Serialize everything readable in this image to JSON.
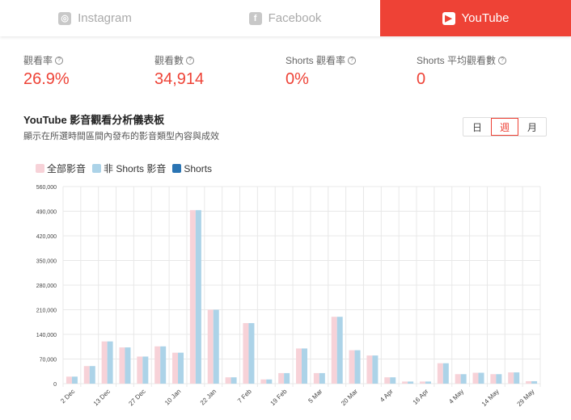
{
  "tabs": [
    {
      "label": "Instagram",
      "icon": "instagram-icon",
      "glyph": "◎"
    },
    {
      "label": "Facebook",
      "icon": "facebook-icon",
      "glyph": "f"
    },
    {
      "label": "YouTube",
      "icon": "youtube-icon",
      "glyph": "▶"
    }
  ],
  "active_tab": 2,
  "metrics": [
    {
      "label": "觀看率",
      "value": "26.9%"
    },
    {
      "label": "觀看數",
      "value": "34,914"
    },
    {
      "label": "Shorts 觀看率",
      "value": "0%"
    },
    {
      "label": "Shorts 平均觀看數",
      "value": "0"
    }
  ],
  "help_glyph": "?",
  "dashboard": {
    "title": "YouTube 影音觀看分析儀表板",
    "subtitle": "顯示在所選時間區間內發布的影音類型內容與成效"
  },
  "period": {
    "options": [
      "日",
      "週",
      "月"
    ],
    "selected": 1
  },
  "colors": {
    "accent": "#ee4236",
    "all": "#f7d2d8",
    "non_shorts": "#acd3e8",
    "shorts": "#2a74b3"
  },
  "chart_data": {
    "type": "bar",
    "legend": [
      "全部影音",
      "非 Shorts 影音",
      "Shorts"
    ],
    "yticks": [
      "0",
      "70,000",
      "140,000",
      "210,000",
      "280,000",
      "350,000",
      "420,000",
      "490,000",
      "560,000"
    ],
    "ylim": [
      0,
      560000
    ],
    "xlabels": [
      "2 Dec",
      "13 Dec",
      "27 Dec",
      "10 Jan",
      "22 Jan",
      "7 Feb",
      "19 Feb",
      "5 Mar",
      "20 Mar",
      "4 Apr",
      "16 Apr",
      "4 May",
      "14 May",
      "29 May"
    ],
    "series": [
      {
        "name": "全部影音",
        "values": [
          20000,
          50000,
          120000,
          103000,
          77000,
          106000,
          88000,
          493000,
          210000,
          18000,
          172000,
          12000,
          30000,
          100000,
          30000,
          190000,
          95000,
          80000,
          18000,
          6000,
          6000,
          58000,
          27000,
          31000,
          27000,
          32000,
          7000
        ]
      },
      {
        "name": "非 Shorts 影音",
        "values": [
          20000,
          50000,
          120000,
          103000,
          77000,
          106000,
          88000,
          493000,
          210000,
          18000,
          172000,
          12000,
          30000,
          100000,
          30000,
          190000,
          95000,
          80000,
          18000,
          6000,
          6000,
          58000,
          27000,
          31000,
          27000,
          32000,
          7000
        ]
      },
      {
        "name": "Shorts",
        "values": [
          0,
          0,
          0,
          0,
          0,
          0,
          0,
          0,
          0,
          0,
          0,
          0,
          0,
          0,
          0,
          0,
          0,
          0,
          0,
          0,
          0,
          0,
          0,
          0,
          0,
          0,
          0
        ]
      }
    ]
  }
}
